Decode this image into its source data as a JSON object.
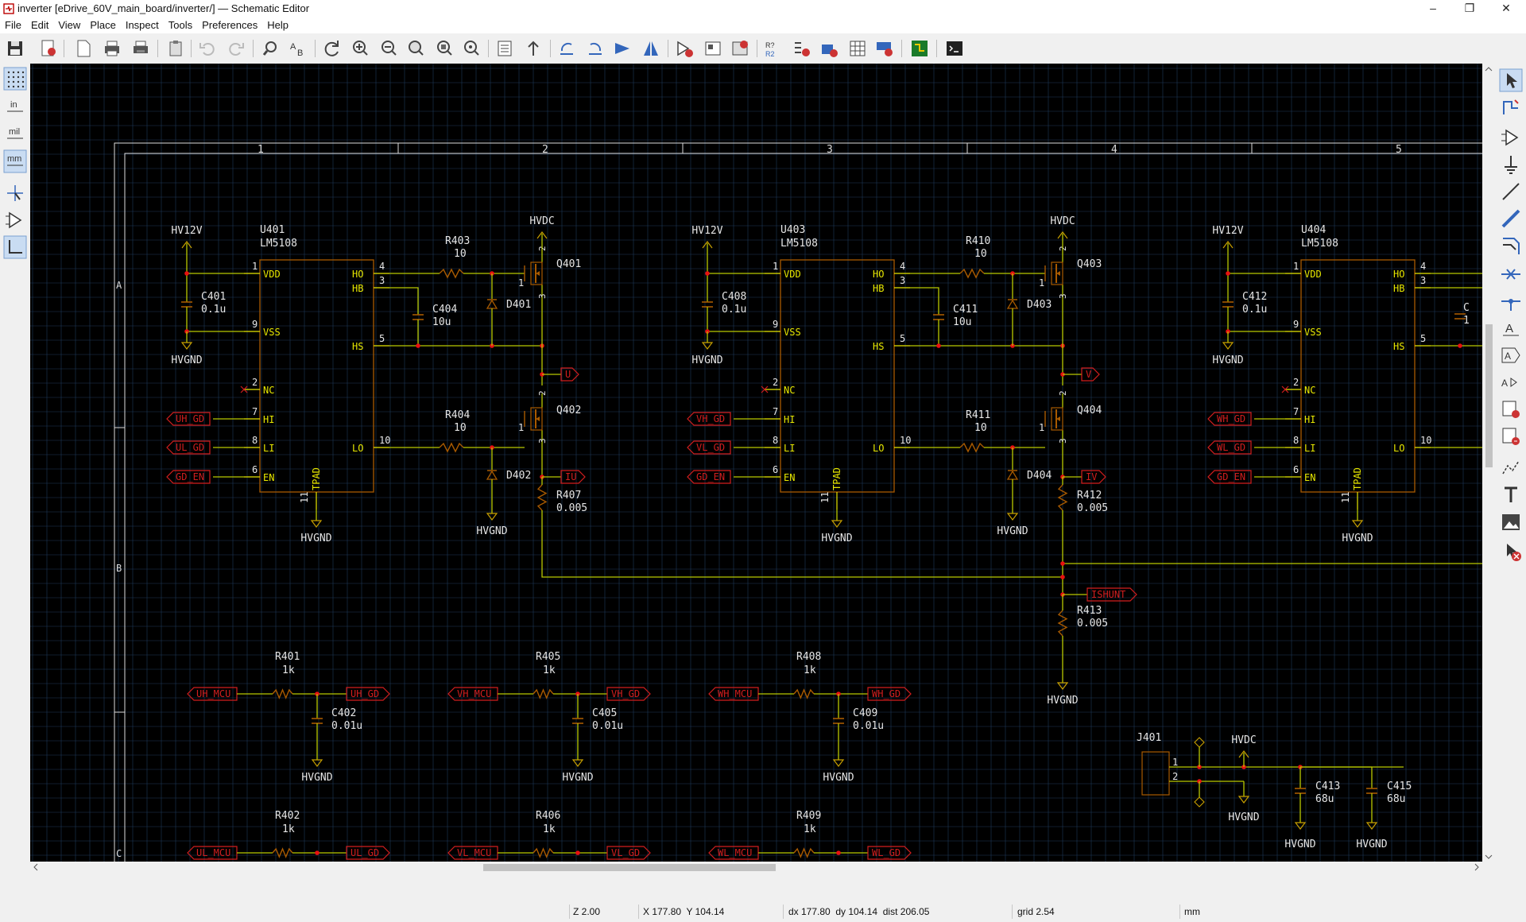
{
  "window": {
    "title": "inverter [eDrive_60V_main_board/inverter/] — Schematic Editor",
    "minimize": "–",
    "maximize": "❐",
    "close": "✕"
  },
  "menu": {
    "items": [
      "File",
      "Edit",
      "View",
      "Place",
      "Inspect",
      "Tools",
      "Preferences",
      "Help"
    ]
  },
  "toolbar": {
    "icons": [
      "save-icon",
      "page-settings-icon",
      "new-sheet-icon",
      "print-icon",
      "plot-icon",
      "paste-icon",
      "undo-icon",
      "redo-icon",
      "find-icon",
      "find-replace-icon",
      "refresh-icon",
      "zoom-in-icon",
      "zoom-out-icon",
      "zoom-fit-icon",
      "zoom-objects-icon",
      "zoom-selection-icon",
      "hierarchy-navigator-icon",
      "leave-sheet-icon",
      "rotate-ccw-icon",
      "rotate-cw-icon",
      "mirror-vertical-icon",
      "mirror-horizontal-icon",
      "symbol-editor-icon",
      "symbol-browser-icon",
      "footprint-assign-icon",
      "annotate-icon",
      "erc-icon",
      "footprint-assign-tool-icon",
      "bom-icon",
      "generate-bom-icon",
      "pcb-editor-icon",
      "scripting-console-icon"
    ]
  },
  "left_toolbar": {
    "units": {
      "inch": "in",
      "mil": "mil",
      "mm": "mm"
    },
    "icons": [
      "grid-toggle-icon",
      "unit-inch-icon",
      "unit-mil-icon",
      "unit-mm-icon",
      "cursor-style-icon",
      "hidden-pins-icon",
      "wire-45-icon"
    ]
  },
  "right_toolbar": {
    "icons": [
      "select-icon",
      "highlight-net-icon",
      "add-symbol-icon",
      "add-power-icon",
      "add-wire-icon",
      "add-bus-icon",
      "add-bus-entry-icon",
      "no-connect-icon",
      "junction-icon",
      "add-label-icon",
      "add-global-label-icon",
      "add-hier-label-icon",
      "add-sheet-icon",
      "import-sheet-pin-icon",
      "add-hier-pin-icon",
      "add-graphic-line-icon",
      "add-text-icon",
      "add-image-icon",
      "delete-icon"
    ]
  },
  "schematic": {
    "border_columns": [
      "1",
      "2",
      "3",
      "4",
      "5"
    ],
    "border_rows": [
      "A",
      "B",
      "C"
    ],
    "colors": {
      "background": "#000000",
      "grid": "#1e3a5a",
      "wire": "#b8c800",
      "symbol_outline": "#a85a00",
      "pin_text": "#e8e800",
      "ref_text": "#e6e6e6",
      "label": "#d21e1e",
      "junction": "#e81010",
      "power_symbol": "#c8a000",
      "border": "#dcdcdc"
    },
    "drivers": [
      {
        "ref": "U401",
        "value": "LM5108",
        "rail": "HV12V",
        "gnd": "HVGND",
        "boot_cap_ref": "C404",
        "boot_cap_val": "10u",
        "dec_cap_ref": "C401",
        "dec_cap_val": "0.1u",
        "hi_label": "UH_GD",
        "lo_label": "UL_GD",
        "en_label": "GD_EN",
        "hs_gate_r": "R403",
        "ls_gate_r": "R404",
        "r_val": "10",
        "d_hi": "D401",
        "d_lo": "D402",
        "q_hi": "Q401",
        "q_lo": "Q402",
        "phase": "U",
        "isense": "IU",
        "shunt_ref": "R407",
        "shunt_val": "0.005",
        "hvdc": "HVDC"
      },
      {
        "ref": "U403",
        "value": "LM5108",
        "rail": "HV12V",
        "gnd": "HVGND",
        "boot_cap_ref": "C411",
        "boot_cap_val": "10u",
        "dec_cap_ref": "C408",
        "dec_cap_val": "0.1u",
        "hi_label": "VH_GD",
        "lo_label": "VL_GD",
        "en_label": "GD_EN",
        "hs_gate_r": "R410",
        "ls_gate_r": "R411",
        "r_val": "10",
        "d_hi": "D403",
        "d_lo": "D404",
        "q_hi": "Q403",
        "q_lo": "Q404",
        "phase": "V",
        "isense": "IV",
        "shunt_ref": "R412",
        "shunt_val": "0.005",
        "hvdc": "HVDC"
      },
      {
        "ref": "U404",
        "value": "LM5108",
        "rail": "HV12V",
        "gnd": "HVGND",
        "dec_cap_ref": "C412",
        "dec_cap_val": "0.1u",
        "boot_cap_ref": "C",
        "boot_cap_val": "1",
        "hi_label": "WH_GD",
        "lo_label": "WL_GD",
        "en_label": "GD_EN"
      }
    ],
    "pin_names": {
      "vdd": "VDD",
      "vss": "VSS",
      "nc": "NC",
      "hi": "HI",
      "li": "LI",
      "en": "EN",
      "ho": "HO",
      "hb": "HB",
      "hs": "HS",
      "lo": "LO",
      "tpad": "TPAD"
    },
    "pin_numbers": {
      "vdd": "1",
      "vss": "9",
      "nc": "2",
      "hi": "7",
      "li": "8",
      "en": "6",
      "ho": "4",
      "hb": "3",
      "hs": "5",
      "lo": "10",
      "tpad": "11",
      "q_g": "1",
      "q_d": "2",
      "q_s": "3"
    },
    "shunt": {
      "label": "ISHUNT",
      "ref": "R413",
      "value": "0.005",
      "gnd": "HVGND"
    },
    "filters_row1": [
      {
        "ref": "R401",
        "val": "1k",
        "in": "UH_MCU",
        "out": "UH_GD",
        "cap": "C402",
        "capval": "0.01u",
        "gnd": "HVGND"
      },
      {
        "ref": "R405",
        "val": "1k",
        "in": "VH_MCU",
        "out": "VH_GD",
        "cap": "C405",
        "capval": "0.01u",
        "gnd": "HVGND"
      },
      {
        "ref": "R408",
        "val": "1k",
        "in": "WH_MCU",
        "out": "WH_GD",
        "cap": "C409",
        "capval": "0.01u",
        "gnd": "HVGND"
      }
    ],
    "filters_row2": [
      {
        "ref": "R402",
        "val": "1k",
        "in": "UL_MCU",
        "out": "UL_GD"
      },
      {
        "ref": "R406",
        "val": "1k",
        "in": "VL_MCU",
        "out": "VL_GD"
      },
      {
        "ref": "R409",
        "val": "1k",
        "in": "WL_MCU",
        "out": "WL_GD"
      }
    ],
    "connector": {
      "ref": "J401",
      "pin1": "1",
      "pin2": "2",
      "hvdc": "HVDC",
      "gnd": "HVGND",
      "c1_ref": "C413",
      "c1_val": "68u",
      "c2_ref": "C415",
      "c2_val": "68u",
      "gnd2": "HVGND",
      "gnd3": "HVGND"
    }
  },
  "status": {
    "zoom": "Z 2.00",
    "cursor": "X 177.80  Y 104.14",
    "delta": "dx 177.80  dy 104.14  dist 206.05",
    "grid": "grid 2.54",
    "units": "mm"
  }
}
